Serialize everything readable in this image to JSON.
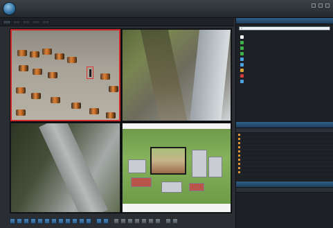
{
  "app": {
    "title": "",
    "menu": [
      "",
      "",
      "",
      ""
    ]
  },
  "tabs": [
    "",
    "",
    "",
    "",
    ""
  ],
  "cameras": [
    {
      "label": ""
    },
    {
      "label": ""
    },
    {
      "label": ""
    },
    {
      "label": ""
    }
  ],
  "device_panel": {
    "title": "",
    "search_placeholder": "",
    "items": [
      {
        "label": "",
        "color": "#ffffff"
      },
      {
        "label": "",
        "color": "#3fb24a"
      },
      {
        "label": "",
        "color": "#3fb24a"
      },
      {
        "label": "",
        "color": "#3fb24a"
      },
      {
        "label": "",
        "color": "#4aa3e0"
      },
      {
        "label": "",
        "color": "#4aa3e0"
      },
      {
        "label": "",
        "color": "#d9a03a"
      },
      {
        "label": "",
        "color": "#d23b3b"
      },
      {
        "label": "",
        "color": "#4aa3e0"
      }
    ]
  },
  "event_panel": {
    "title": "",
    "columns": [
      "",
      "",
      ""
    ],
    "rows": [
      [
        "",
        "",
        ""
      ],
      [
        "",
        "",
        ""
      ],
      [
        "",
        "",
        ""
      ],
      [
        "",
        "",
        ""
      ],
      [
        "",
        "",
        ""
      ],
      [
        "",
        "",
        ""
      ],
      [
        "",
        "",
        ""
      ],
      [
        "",
        "",
        ""
      ],
      [
        "",
        "",
        ""
      ],
      [
        "",
        "",
        ""
      ]
    ]
  },
  "ptz_panel": {
    "title": "",
    "columns": [
      "",
      ""
    ]
  },
  "colors": {
    "selection": "#d22a2a",
    "accent": "#2f5f88",
    "alarm_text": "#d7a453",
    "info_text": "#59b0e0"
  }
}
